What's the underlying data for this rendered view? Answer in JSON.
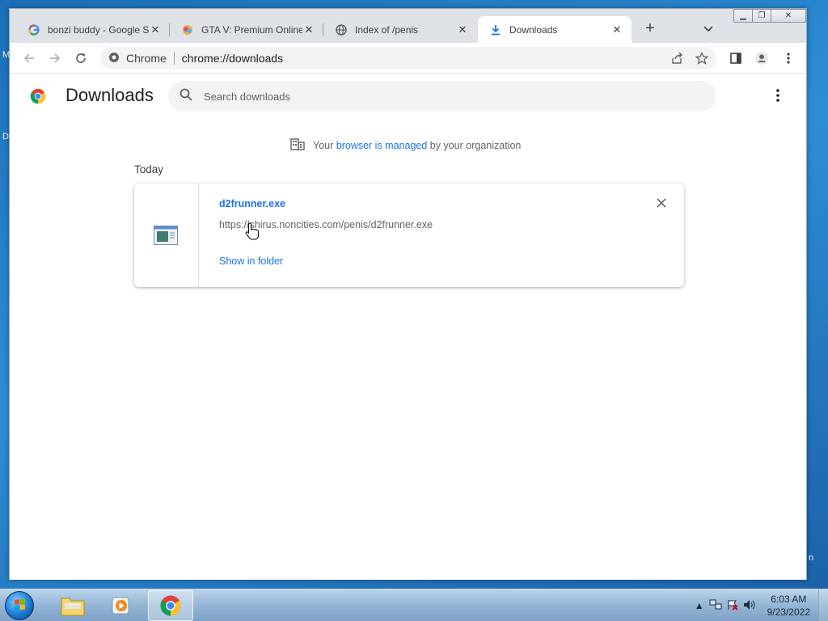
{
  "desktop": {
    "frag1": "M",
    "frag2": "D",
    "frag3": "n"
  },
  "window": {
    "tabs": [
      {
        "title": "bonzi buddy - Google S",
        "icon": "google-icon"
      },
      {
        "title": "GTA V: Premium Online",
        "icon": "gta-icon"
      },
      {
        "title": "Index of /penis",
        "icon": "globe-icon"
      },
      {
        "title": "Downloads",
        "icon": "download-icon",
        "active": true
      }
    ],
    "omnibox": {
      "chip": "Chrome",
      "url": "chrome://downloads"
    }
  },
  "page": {
    "title": "Downloads",
    "search_placeholder": "Search downloads",
    "managed": {
      "prefix": "Your",
      "link": "browser is managed",
      "suffix": "by your organization"
    },
    "section": "Today",
    "download": {
      "filename": "d2frunner.exe",
      "url": "https://shirus.noncities.com/penis/d2frunner.exe",
      "action": "Show in folder"
    }
  },
  "taskbar": {
    "time": "6:03 AM",
    "date": "9/23/2022"
  },
  "colors": {
    "accent": "#1a73e8",
    "tabstrip": "#dee1e6",
    "search": "#f1f3f4"
  }
}
